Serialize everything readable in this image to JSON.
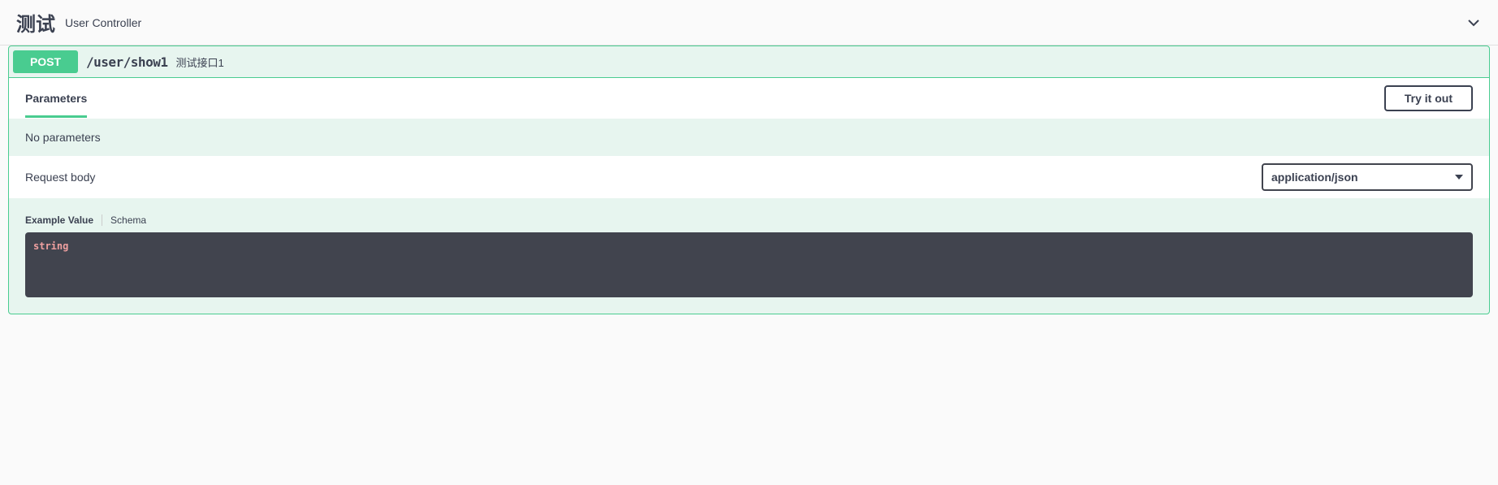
{
  "tag": {
    "title": "测试",
    "description": "User Controller"
  },
  "operation": {
    "method": "POST",
    "path": "/user/show1",
    "summary": "测试接口1"
  },
  "parameters": {
    "title": "Parameters",
    "try_label": "Try it out",
    "empty_text": "No parameters"
  },
  "request_body": {
    "title": "Request body",
    "content_type_selected": "application/json",
    "tabs": {
      "example": "Example Value",
      "schema": "Schema"
    },
    "example_value": "string"
  }
}
